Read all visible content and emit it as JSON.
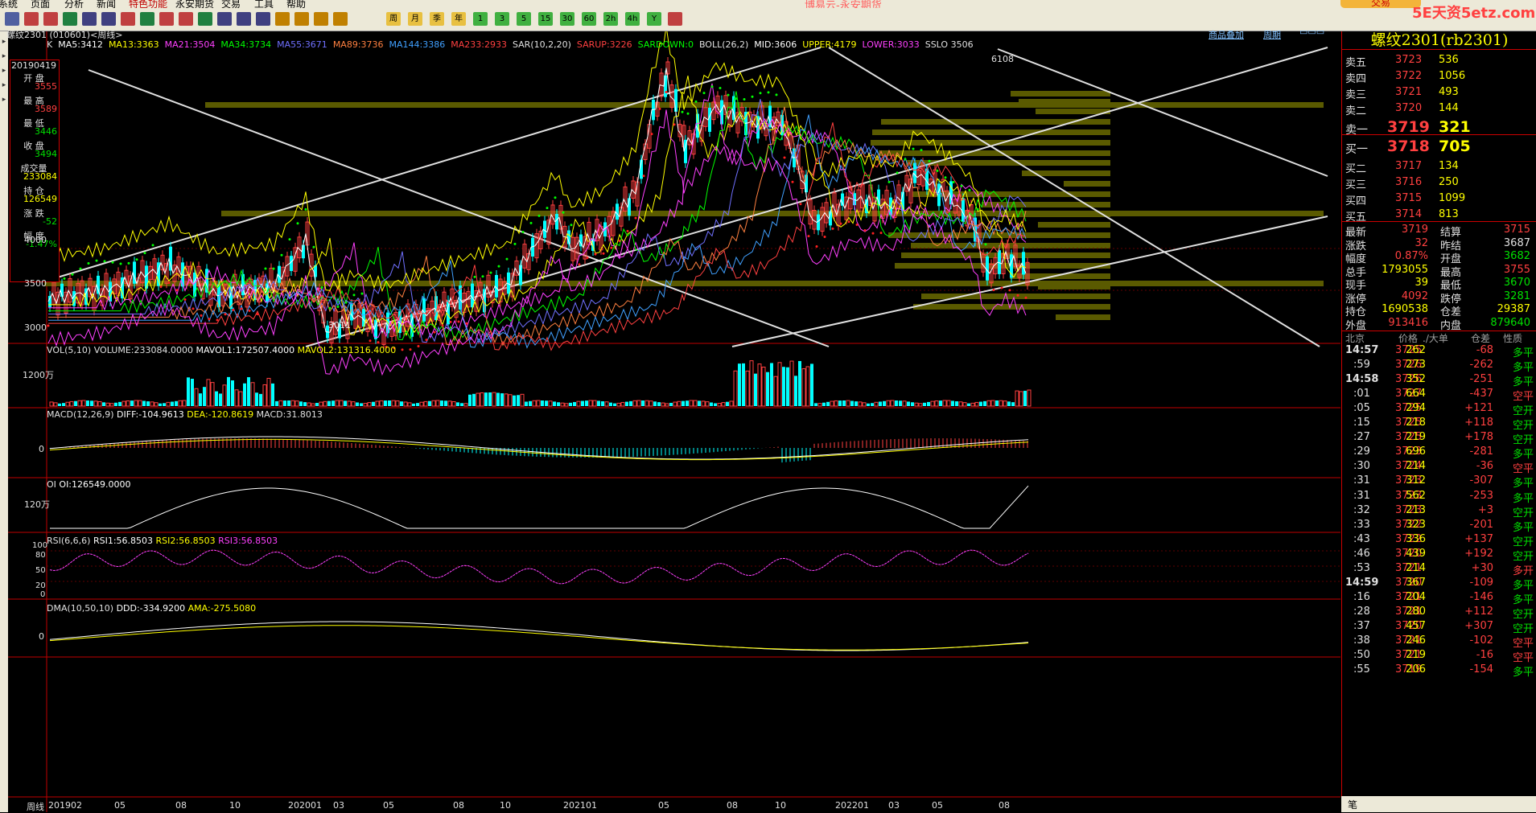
{
  "menu": {
    "items": [
      "系统",
      "页面",
      "分析",
      "新闻",
      "特色功能",
      "永安期货",
      "交易",
      "工具",
      "帮助"
    ],
    "title": "博易云-永安期货",
    "trade_label": "交易",
    "logo": "5E天资5etz.com"
  },
  "toolbar": {
    "buttons": [
      "周",
      "月",
      "季",
      "年",
      "1",
      "3",
      "5",
      "15",
      "30",
      "60",
      "2h",
      "4h",
      "Y"
    ]
  },
  "chart": {
    "instrument_title": "螺纹2301 (010601)<周线>",
    "tab_overlay": "商品叠加",
    "tab_period": "周期",
    "indicator_line": [
      "K",
      "MA5:3412",
      "MA13:3363",
      "MA21:3504",
      "MA34:3734",
      "MA55:3671",
      "MA89:3736",
      "MA144:3386",
      "MA233:2933",
      "SAR(10,2,20)",
      "SARUP:3226",
      "SARDOWN:0",
      "BOLL(26,2)",
      "MID:3606",
      "UPPER:4179",
      "LOWER:3033",
      "SSLO 3506"
    ],
    "indicator_colors": [
      "#e0e0e0",
      "#ffffff",
      "#ffff00",
      "#ff40ff",
      "#00ff00",
      "#7070ff",
      "#ff8040",
      "#40a0ff",
      "#ff4040",
      "#e0e0e0",
      "#ff4040",
      "#00ff00",
      "#e0e0e0",
      "#ffffff",
      "#ffff00",
      "#ff40ff",
      "#e0e0e0"
    ],
    "price_axis": [
      "4000",
      "3500",
      "3000"
    ],
    "peak_label": "6108",
    "low_label": "3011",
    "x_axis": [
      "201902",
      "05",
      "08",
      "10",
      "202001",
      "03",
      "05",
      "08",
      "10",
      "202101",
      "05",
      "08",
      "10",
      "202201",
      "03",
      "05",
      "08"
    ],
    "x_axis_title": "周线",
    "vol_header": {
      "title": "VOL(5,10)",
      "volume": "VOLUME:233084.0000",
      "mavol1": "MAVOL1:172507.4000",
      "mavol2": "MAVOL2:131316.4000",
      "axis": "1200万"
    },
    "macd_header": {
      "title": "MACD(12,26,9)",
      "diff": "DIFF:-104.9613",
      "dea": "DEA:-120.8619",
      "macd": "MACD:31.8013",
      "axis": "0"
    },
    "oi_header": {
      "title": "OI",
      "oi": "OI:126549.0000",
      "axis": "120万"
    },
    "rsi_header": {
      "title": "RSI(6,6,6)",
      "rsi1": "RSI1:56.8503",
      "rsi2": "RSI2:56.8503",
      "rsi3": "RSI3:56.8503",
      "axis": [
        "100",
        "80",
        "50",
        "20",
        "0"
      ]
    },
    "dma_header": {
      "title": "DMA(10,50,10)",
      "ddd": "DDD:-334.9200",
      "ama": "AMA:-275.5080",
      "axis": "0"
    }
  },
  "infobox": {
    "date": "20190419",
    "items": [
      {
        "label": "开  盘",
        "value": "3555",
        "color": "#ff4040"
      },
      {
        "label": "最  高",
        "value": "3589",
        "color": "#ff4040"
      },
      {
        "label": "最  低",
        "value": "3446",
        "color": "#00e000"
      },
      {
        "label": "收  盘",
        "value": "3494",
        "color": "#00e000"
      },
      {
        "label": "成交量",
        "value": "233084",
        "color": "#ffff00"
      },
      {
        "label": "持  仓",
        "value": "126549",
        "color": "#ffff00"
      },
      {
        "label": "涨  跌",
        "value": "-52",
        "color": "#00e000"
      },
      {
        "label": "幅  度",
        "value": "-1.47%",
        "color": "#00e000"
      }
    ]
  },
  "quote": {
    "title": "螺纹2301(rb2301)",
    "asks": [
      {
        "label": "卖五",
        "price": "3723",
        "vol": "536"
      },
      {
        "label": "卖四",
        "price": "3722",
        "vol": "1056"
      },
      {
        "label": "卖三",
        "price": "3721",
        "vol": "493"
      },
      {
        "label": "卖二",
        "price": "3720",
        "vol": "144"
      },
      {
        "label": "卖一",
        "price": "3719",
        "vol": "321"
      }
    ],
    "bids": [
      {
        "label": "买一",
        "price": "3718",
        "vol": "705"
      },
      {
        "label": "买二",
        "price": "3717",
        "vol": "134"
      },
      {
        "label": "买三",
        "price": "3716",
        "vol": "250"
      },
      {
        "label": "买四",
        "price": "3715",
        "vol": "1099"
      },
      {
        "label": "买五",
        "price": "3714",
        "vol": "813"
      }
    ],
    "stats": [
      {
        "l1": "最新",
        "v1": "3719",
        "c1": "#ff4040",
        "l2": "结算",
        "v2": "3715",
        "c2": "#ff4040"
      },
      {
        "l1": "涨跌",
        "v1": "32",
        "c1": "#ff4040",
        "l2": "昨结",
        "v2": "3687",
        "c2": "#e0e0e0"
      },
      {
        "l1": "幅度",
        "v1": "0.87%",
        "c1": "#ff4040",
        "l2": "开盘",
        "v2": "3682",
        "c2": "#00e000"
      },
      {
        "l1": "总手",
        "v1": "1793055",
        "c1": "#ffff00",
        "l2": "最高",
        "v2": "3755",
        "c2": "#ff4040"
      },
      {
        "l1": "现手",
        "v1": "39",
        "c1": "#ffff00",
        "l2": "最低",
        "v2": "3670",
        "c2": "#00e000"
      },
      {
        "l1": "涨停",
        "v1": "4092",
        "c1": "#ff4040",
        "l2": "跌停",
        "v2": "3281",
        "c2": "#00e000"
      },
      {
        "l1": "持仓",
        "v1": "1690538",
        "c1": "#ffff00",
        "l2": "仓差",
        "v2": "29387",
        "c2": "#ffff00"
      },
      {
        "l1": "外盘",
        "v1": "913416",
        "c1": "#ff4040",
        "l2": "内盘",
        "v2": "879640",
        "c2": "#00e000"
      }
    ],
    "tick_header": [
      "北京",
      "价格",
      "./大单",
      "仓差",
      "性质"
    ],
    "ticks": [
      {
        "t": "14:57",
        "p": "3725",
        "v": "262",
        "d": "-68",
        "n": "多平",
        "pc": "#ff4040",
        "nc": "#00e000",
        "bold": true
      },
      {
        "t": ":59",
        "p": "3726",
        "v": "273",
        "d": "-262",
        "n": "多平",
        "pc": "#ff4040",
        "nc": "#00e000",
        "bold": false
      },
      {
        "t": "14:58",
        "p": "3726",
        "v": "352",
        "d": "-251",
        "n": "多平",
        "pc": "#ff4040",
        "nc": "#00e000",
        "bold": true
      },
      {
        "t": ":01",
        "p": "3727",
        "v": "664",
        "d": "-437",
        "n": "空平",
        "pc": "#ff4040",
        "nc": "#ff4040",
        "bold": false
      },
      {
        "t": ":05",
        "p": "3725",
        "v": "294",
        "d": "+121",
        "n": "空开",
        "pc": "#ff4040",
        "nc": "#00e000",
        "bold": false
      },
      {
        "t": ":15",
        "p": "3725",
        "v": "218",
        "d": "+118",
        "n": "空开",
        "pc": "#ff4040",
        "nc": "#00e000",
        "bold": false
      },
      {
        "t": ":27",
        "p": "3725",
        "v": "219",
        "d": "+178",
        "n": "空开",
        "pc": "#ff4040",
        "nc": "#00e000",
        "bold": false
      },
      {
        "t": ":29",
        "p": "3723",
        "v": "696",
        "d": "-281",
        "n": "多平",
        "pc": "#ff4040",
        "nc": "#00e000",
        "bold": false
      },
      {
        "t": ":30",
        "p": "3724",
        "v": "214",
        "d": "-36",
        "n": "空平",
        "pc": "#ff4040",
        "nc": "#ff4040",
        "bold": false
      },
      {
        "t": ":31",
        "p": "3723",
        "v": "312",
        "d": "-307",
        "n": "多平",
        "pc": "#ff4040",
        "nc": "#00e000",
        "bold": false
      },
      {
        "t": ":31",
        "p": "3723",
        "v": "562",
        "d": "-253",
        "n": "多平",
        "pc": "#ff4040",
        "nc": "#00e000",
        "bold": false
      },
      {
        "t": ":32",
        "p": "3723",
        "v": "213",
        "d": "+3",
        "n": "空开",
        "pc": "#ff4040",
        "nc": "#00e000",
        "bold": false
      },
      {
        "t": ":33",
        "p": "3722",
        "v": "323",
        "d": "-201",
        "n": "多平",
        "pc": "#ff4040",
        "nc": "#00e000",
        "bold": false
      },
      {
        "t": ":43",
        "p": "3722",
        "v": "336",
        "d": "+137",
        "n": "空开",
        "pc": "#ff4040",
        "nc": "#00e000",
        "bold": false
      },
      {
        "t": ":46",
        "p": "3720",
        "v": "439",
        "d": "+192",
        "n": "空开",
        "pc": "#ff4040",
        "nc": "#00e000",
        "bold": false
      },
      {
        "t": ":53",
        "p": "3721",
        "v": "214",
        "d": "+30",
        "n": "多开",
        "pc": "#ff4040",
        "nc": "#ff4040",
        "bold": false
      },
      {
        "t": "14:59",
        "p": "3720",
        "v": "367",
        "d": "-109",
        "n": "多平",
        "pc": "#ff4040",
        "nc": "#00e000",
        "bold": true
      },
      {
        "t": ":16",
        "p": "3721",
        "v": "204",
        "d": "-146",
        "n": "多平",
        "pc": "#ff4040",
        "nc": "#00e000",
        "bold": false
      },
      {
        "t": ":28",
        "p": "3721",
        "v": "280",
        "d": "+112",
        "n": "空开",
        "pc": "#ff4040",
        "nc": "#00e000",
        "bold": false
      },
      {
        "t": ":37",
        "p": "3720",
        "v": "457",
        "d": "+307",
        "n": "空开",
        "pc": "#ff4040",
        "nc": "#00e000",
        "bold": false
      },
      {
        "t": ":38",
        "p": "3721",
        "v": "246",
        "d": "-102",
        "n": "空平",
        "pc": "#ff4040",
        "nc": "#ff4040",
        "bold": false
      },
      {
        "t": ":50",
        "p": "3721",
        "v": "219",
        "d": "-16",
        "n": "空平",
        "pc": "#ff4040",
        "nc": "#ff4040",
        "bold": false
      },
      {
        "t": ":55",
        "p": "3719",
        "v": "206",
        "d": "-154",
        "n": "多平",
        "pc": "#ff4040",
        "nc": "#00e000",
        "bold": false
      }
    ],
    "bottom_label": "笔"
  }
}
